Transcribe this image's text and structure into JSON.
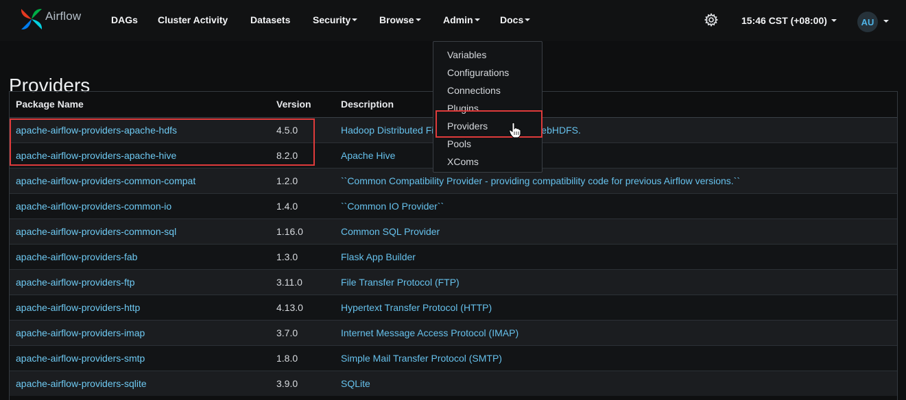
{
  "brand": {
    "name": "Airflow"
  },
  "nav": {
    "dags": "DAGs",
    "cluster_activity": "Cluster Activity",
    "datasets": "Datasets",
    "security": "Security",
    "browse": "Browse",
    "admin": "Admin",
    "docs": "Docs",
    "clock": "15:46 CST (+08:00)",
    "avatar": "AU"
  },
  "admin_menu": {
    "items": [
      "Variables",
      "Configurations",
      "Connections",
      "Plugins",
      "Providers",
      "Pools",
      "XComs"
    ]
  },
  "page": {
    "title": "Providers"
  },
  "table": {
    "headers": {
      "package": "Package Name",
      "version": "Version",
      "description": "Description"
    },
    "rows": [
      {
        "package": "apache-airflow-providers-apache-hdfs",
        "version": "4.5.0",
        "description": "Hadoop Distributed File System (HDFS) and WebHDFS."
      },
      {
        "package": "apache-airflow-providers-apache-hive",
        "version": "8.2.0",
        "description": "Apache Hive"
      },
      {
        "package": "apache-airflow-providers-common-compat",
        "version": "1.2.0",
        "description": "``Common Compatibility Provider - providing compatibility code for previous Airflow versions.``"
      },
      {
        "package": "apache-airflow-providers-common-io",
        "version": "1.4.0",
        "description": "``Common IO Provider``"
      },
      {
        "package": "apache-airflow-providers-common-sql",
        "version": "1.16.0",
        "description": "Common SQL Provider"
      },
      {
        "package": "apache-airflow-providers-fab",
        "version": "1.3.0",
        "description": "Flask App Builder"
      },
      {
        "package": "apache-airflow-providers-ftp",
        "version": "3.11.0",
        "description": "File Transfer Protocol (FTP)"
      },
      {
        "package": "apache-airflow-providers-http",
        "version": "4.13.0",
        "description": "Hypertext Transfer Protocol (HTTP)"
      },
      {
        "package": "apache-airflow-providers-imap",
        "version": "3.7.0",
        "description": "Internet Message Access Protocol (IMAP)"
      },
      {
        "package": "apache-airflow-providers-smtp",
        "version": "1.8.0",
        "description": "Simple Mail Transfer Protocol (SMTP)"
      },
      {
        "package": "apache-airflow-providers-sqlite",
        "version": "3.9.0",
        "description": "SQLite"
      }
    ]
  },
  "colors": {
    "link": "#6ec9f2",
    "highlight": "#e03b3b",
    "background": "#0e0f10"
  }
}
